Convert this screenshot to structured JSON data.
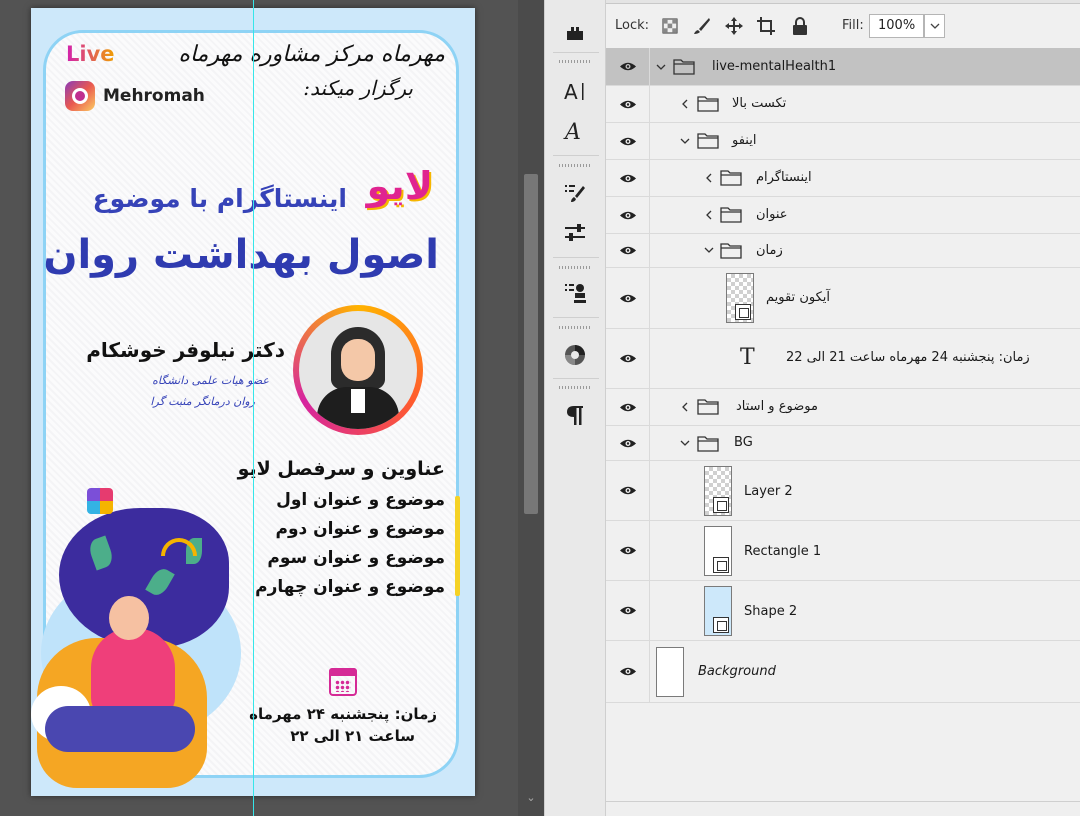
{
  "canvas": {
    "poster": {
      "live_label": "Live",
      "instagram_handle": "Mehromah",
      "organizer_line1": "مهرماه مرکز مشاوره مهرماه",
      "organizer_line2": "برگزار میکند:",
      "live_word": "لایو",
      "subtitle": "اینستاگرام با موضوع",
      "main_title": "اصول بهداشت روان",
      "doctor_name": "دکتر نیلوفر خوشکام",
      "doctor_role1": "عضو هیات علمی دانشگاه",
      "doctor_role2": "روان درمانگر مثبت گرا",
      "topics_title": "عناوین و سرفصل لایو",
      "topics": [
        "موضوع و عنوان اول",
        "موضوع و عنوان دوم",
        "موضوع و عنوان سوم",
        "موضوع و عنوان چهارم"
      ],
      "time_line1": "زمان: پنجشنبه ۲۴ مهرماه",
      "time_line2": "ساعت ۲۱ الی ۲۲"
    }
  },
  "tools": {
    "items": [
      "stamp-tool",
      "character-panel",
      "glyphs-panel",
      "brush-settings",
      "adjustments",
      "clone-source",
      "color-wheel",
      "paragraph-panel"
    ]
  },
  "layers_panel": {
    "lock_label": "Lock:",
    "fill_label": "Fill:",
    "fill_value": "100%",
    "layers": [
      {
        "name": "live-mentalHealth1",
        "type": "group",
        "selected": true
      },
      {
        "name": "تکست بالا",
        "type": "group"
      },
      {
        "name": "اینفو",
        "type": "group"
      },
      {
        "name": "اینستاگرام",
        "type": "group"
      },
      {
        "name": "عنوان",
        "type": "group"
      },
      {
        "name": "زمان",
        "type": "group"
      },
      {
        "name": "آیکون تقویم",
        "type": "shape"
      },
      {
        "name": "زمان: پنجشنبه 24 مهرماه  ساعت 21 الی 22",
        "type": "text"
      },
      {
        "name": "موضوع و استاد",
        "type": "group"
      },
      {
        "name": "BG",
        "type": "group"
      },
      {
        "name": "Layer 2",
        "type": "smart-object"
      },
      {
        "name": "Rectangle 1",
        "type": "shape"
      },
      {
        "name": "Shape 2",
        "type": "shape"
      },
      {
        "name": "Background",
        "type": "background"
      }
    ]
  },
  "colors": {
    "accent_blue": "#3643b8",
    "accent_pink": "#e02490",
    "guide_cyan": "#35e6ea",
    "selection_gray": "#c2c2c2"
  }
}
